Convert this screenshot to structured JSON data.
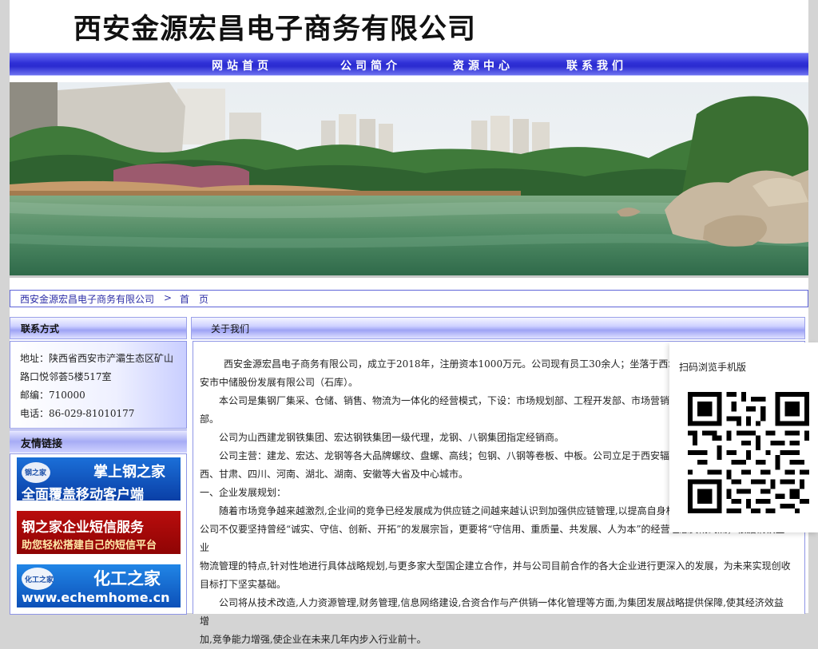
{
  "site": {
    "title": "西安金源宏昌电子商务有限公司"
  },
  "nav": {
    "items": [
      {
        "label": "网站首页"
      },
      {
        "label": "公司简介"
      },
      {
        "label": "资源中心"
      },
      {
        "label": "联系我们"
      }
    ]
  },
  "breadcrumb": {
    "company": "西安金源宏昌电子商务有限公司",
    "separator": ">",
    "current": "首　页"
  },
  "sidebar": {
    "contact": {
      "heading": "联系方式",
      "address_line1": "地址：陕西省西安市浐灞生态区矿山",
      "address_line2": "路口悦邻荟5楼517室",
      "postcode": "邮编：710000",
      "phone": "电话：86-029-81010177"
    },
    "links": {
      "heading": "友情链接",
      "ads": [
        {
          "brand": "钢之家",
          "headline": "掌上钢之家",
          "tagline": "全面覆盖移动客户端"
        },
        {
          "headline": "钢之家企业短信服务",
          "tagline": "助您轻松搭建自己的短信平台"
        },
        {
          "brand": "化工之家",
          "headline": "化工之家",
          "url_text": "www.echemhome.cn"
        }
      ]
    }
  },
  "about": {
    "heading": "关于我们",
    "p1a": "西安金源宏昌电子商务有限公司，成立于2018年，注册资本1000万元。公司现有员工30余人；坐落于西北最",
    "p1b": "安市中储股份发展有限公司（石库）。",
    "p2a": "本公司是集钢厂集采、仓储、销售、物流为一体化的经营模式，下设：市场规划部、工程开发部、市场营销",
    "p2b": "部。",
    "p3": "公司为山西建龙钢铁集团、宏达钢铁集团一级代理，龙钢、八钢集团指定经销商。",
    "p4a": "公司主营：建龙、宏达、龙钢等各大品牌螺纹、盘螺、高线；包钢、八钢等卷板、中板。公司立足于西安辐",
    "p4b": "西、甘肃、四川、河南、湖北、湖南、安徽等大省及中心城市。",
    "h1": "一、企业发展规划：",
    "p5a": "随着市场竞争越来越激烈,企业间的竞争已经发展成为供应链之间越来越认识到加强供应链管理,以提高自身核",
    "p5b": "公司不仅要坚持曾经“诚实、守信、创新、开拓”的发展宗旨，更要将“守信用、重质量、共发展、人为本”的经营理念贯彻到底，根据钢铁企业",
    "p5c": "物流管理的特点,针对性地进行具体战略规划,与更多家大型国企建立合作，并与公司目前合作的各大企业进行更深入的发展，为未来实现创收",
    "p5d": "目标打下坚实基础。",
    "p6a": "公司将从技术改造,人力资源管理,财务管理,信息网络建设,合资合作与产供销一体化管理等方面,为集团发展战略提供保障,使其经济效益增",
    "p6b": "加,竞争能力增强,使企业在未来几年内步入行业前十。"
  },
  "qr": {
    "title": "扫码浏览手机版"
  }
}
